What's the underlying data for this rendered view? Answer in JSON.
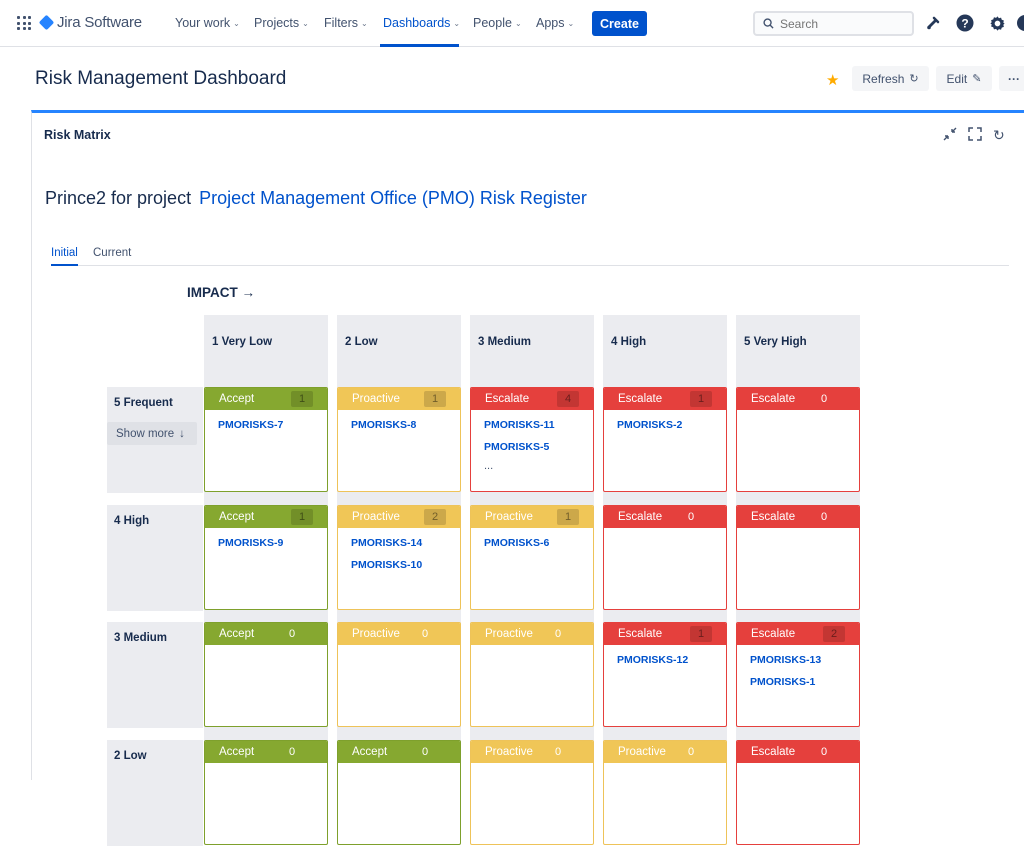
{
  "nav": {
    "logo_text": "Jira Software",
    "items": [
      {
        "label": "Your work",
        "active": false
      },
      {
        "label": "Projects",
        "active": false
      },
      {
        "label": "Filters",
        "active": false
      },
      {
        "label": "Dashboards",
        "active": true
      },
      {
        "label": "People",
        "active": false
      },
      {
        "label": "Apps",
        "active": false
      }
    ],
    "create_label": "Create",
    "search_placeholder": "Search",
    "icons": [
      "notifications-icon",
      "help-icon",
      "settings-icon"
    ]
  },
  "page": {
    "title": "Risk Management Dashboard",
    "refresh_label": "Refresh",
    "edit_label": "Edit",
    "more_label": "···"
  },
  "gadget": {
    "title": "Risk Matrix",
    "project_prefix": "Prince2 for project",
    "project_link": "Project Management Office (PMO) Risk Register",
    "tabs": [
      {
        "label": "Initial",
        "active": true
      },
      {
        "label": "Current",
        "active": false
      }
    ],
    "impact_label": "IMPACT →",
    "show_more_label": "Show more"
  },
  "matrix": {
    "columns": [
      "1 Very Low",
      "2 Low",
      "3 Medium",
      "4 High",
      "5 Very High"
    ],
    "rows": [
      {
        "label": "5 Frequent",
        "cells": [
          {
            "action": "Accept",
            "color": "green",
            "count": "1",
            "issues": [
              "PMORISKS-7"
            ],
            "more": false
          },
          {
            "action": "Proactive",
            "color": "yellow",
            "count": "1",
            "issues": [
              "PMORISKS-8"
            ],
            "more": false
          },
          {
            "action": "Escalate",
            "color": "red",
            "count": "4",
            "issues": [
              "PMORISKS-11",
              "PMORISKS-5"
            ],
            "more": true
          },
          {
            "action": "Escalate",
            "color": "red",
            "count": "1",
            "issues": [
              "PMORISKS-2"
            ],
            "more": false
          },
          {
            "action": "Escalate",
            "color": "red",
            "count": "0",
            "issues": [],
            "more": false
          }
        ]
      },
      {
        "label": "4 High",
        "cells": [
          {
            "action": "Accept",
            "color": "green",
            "count": "1",
            "issues": [
              "PMORISKS-9"
            ],
            "more": false
          },
          {
            "action": "Proactive",
            "color": "yellow",
            "count": "2",
            "issues": [
              "PMORISKS-14",
              "PMORISKS-10"
            ],
            "more": false
          },
          {
            "action": "Proactive",
            "color": "yellow",
            "count": "1",
            "issues": [
              "PMORISKS-6"
            ],
            "more": false
          },
          {
            "action": "Escalate",
            "color": "red",
            "count": "0",
            "issues": [],
            "more": false
          },
          {
            "action": "Escalate",
            "color": "red",
            "count": "0",
            "issues": [],
            "more": false
          }
        ]
      },
      {
        "label": "3 Medium",
        "cells": [
          {
            "action": "Accept",
            "color": "green",
            "count": "0",
            "issues": [],
            "more": false
          },
          {
            "action": "Proactive",
            "color": "yellow",
            "count": "0",
            "issues": [],
            "more": false
          },
          {
            "action": "Proactive",
            "color": "yellow",
            "count": "0",
            "issues": [],
            "more": false
          },
          {
            "action": "Escalate",
            "color": "red",
            "count": "1",
            "issues": [
              "PMORISKS-12"
            ],
            "more": false
          },
          {
            "action": "Escalate",
            "color": "red",
            "count": "2",
            "issues": [
              "PMORISKS-13",
              "PMORISKS-1"
            ],
            "more": false
          }
        ]
      },
      {
        "label": "2 Low",
        "cells": [
          {
            "action": "Accept",
            "color": "green",
            "count": "0",
            "issues": [],
            "more": false
          },
          {
            "action": "Accept",
            "color": "green",
            "count": "0",
            "issues": [],
            "more": false
          },
          {
            "action": "Proactive",
            "color": "yellow",
            "count": "0",
            "issues": [],
            "more": false
          },
          {
            "action": "Proactive",
            "color": "yellow",
            "count": "0",
            "issues": [],
            "more": false
          },
          {
            "action": "Escalate",
            "color": "red",
            "count": "0",
            "issues": [],
            "more": false
          }
        ]
      }
    ]
  }
}
